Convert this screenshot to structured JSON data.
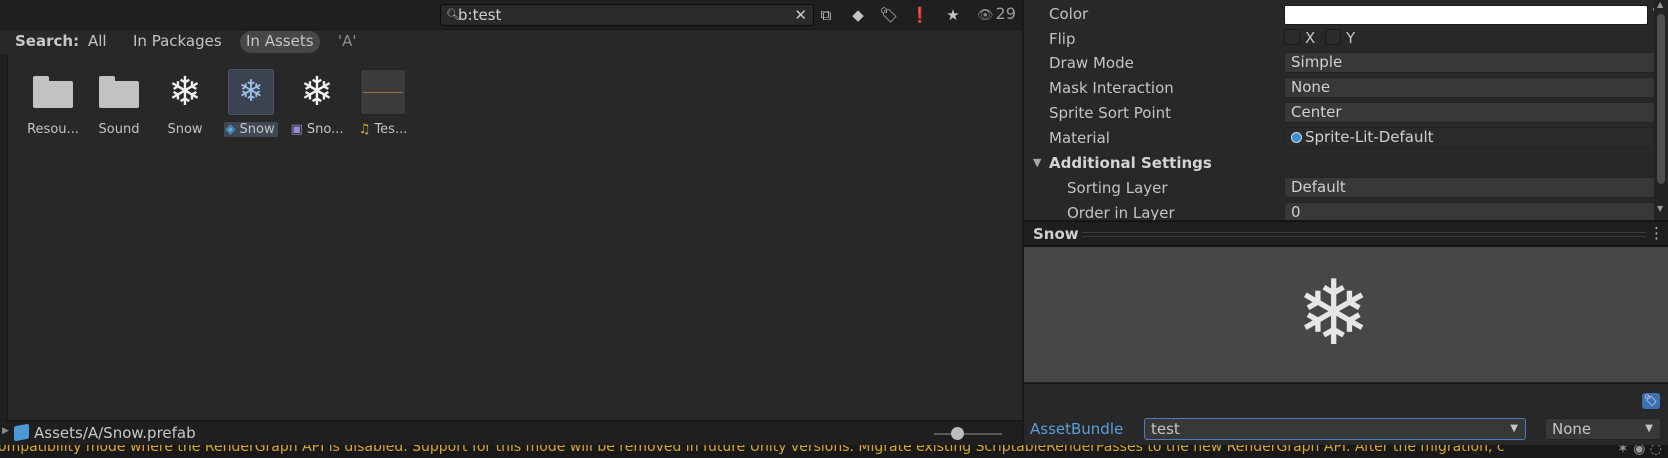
{
  "project": {
    "search": {
      "value": "b:test",
      "clear_glyph": "✕"
    },
    "toolbar_icons": [
      {
        "name": "search-in-scene-icon",
        "glyph": "⧉"
      },
      {
        "name": "type-filter-icon",
        "glyph": "◆"
      },
      {
        "name": "label-filter-icon",
        "glyph": "🏷"
      },
      {
        "name": "log-filter-icon",
        "glyph": "❗"
      },
      {
        "name": "favorite-icon",
        "glyph": "★"
      }
    ],
    "hidden_count": "29",
    "scope": {
      "label": "Search:",
      "options": [
        "All",
        "In Packages",
        "In Assets",
        "'A'"
      ],
      "active": "In Assets"
    },
    "assets": [
      {
        "label": "Resou...",
        "kind": "folder",
        "badge": ""
      },
      {
        "label": "Sound",
        "kind": "folder",
        "badge": ""
      },
      {
        "label": "Snow",
        "kind": "texture",
        "badge": ""
      },
      {
        "label": "Snow",
        "kind": "prefab",
        "badge": "prefab-icon"
      },
      {
        "label": "Sno...",
        "kind": "sprite",
        "badge": "sprite-icon"
      },
      {
        "label": "Tes...",
        "kind": "audio",
        "badge": "audio-icon"
      }
    ],
    "path": "Assets/A/Snow.prefab",
    "zoom_level": 0.35
  },
  "inspector": {
    "color_label": "Color",
    "color_value": "#ffffff",
    "flip_label": "Flip",
    "flip_x": "X",
    "flip_y": "Y",
    "draw_mode_label": "Draw Mode",
    "draw_mode": "Simple",
    "mask_label": "Mask Interaction",
    "mask": "None",
    "sort_point_label": "Sprite Sort Point",
    "sort_point": "Center",
    "material_label": "Material",
    "material": "Sprite-Lit-Default",
    "additional_label": "Additional Settings",
    "sorting_layer_label": "Sorting Layer",
    "sorting_layer": "Default",
    "order_label": "Order in Layer",
    "order": "0"
  },
  "preview": {
    "title": "Snow",
    "menu_glyph": "⋮"
  },
  "asset_bundle": {
    "label": "AssetBundle",
    "name": "test",
    "variant": "None"
  },
  "status": {
    "message": "ompatibility mode where the RenderGraph API is disabled. Support for this mode will be removed in future Unity versions. Migrate existing ScriptableRenderPasses to the new RenderGraph API. After the migration, c"
  },
  "colors": {
    "warning": "#d9a82b",
    "accent": "#5d9ee0",
    "selection": "#404856"
  }
}
